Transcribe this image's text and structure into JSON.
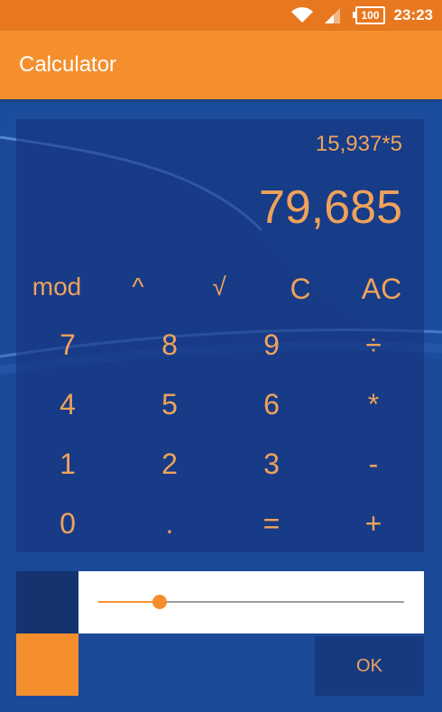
{
  "status_bar": {
    "battery": "100",
    "time": "23:23",
    "wifi_icon": "wifi-icon",
    "signal_icon": "signal-icon"
  },
  "app_bar": {
    "title": "Calculator"
  },
  "display": {
    "expression": "15,937*5",
    "result": "79,685"
  },
  "keypad": {
    "rows": [
      [
        "mod",
        "^",
        "√",
        "C",
        "AC"
      ],
      [
        "7",
        "8",
        "9",
        "÷"
      ],
      [
        "4",
        "5",
        "6",
        "*"
      ],
      [
        "1",
        "2",
        "3",
        "-"
      ],
      [
        "0",
        ".",
        "=",
        "+"
      ]
    ]
  },
  "dialog": {
    "slider_value_fraction": 0.2,
    "ok_label": "OK"
  },
  "colors": {
    "status_bar": "#e8781f",
    "app_bar": "#f58f2e",
    "background": "#1c4d9c",
    "accent_text": "#f0a25a"
  }
}
